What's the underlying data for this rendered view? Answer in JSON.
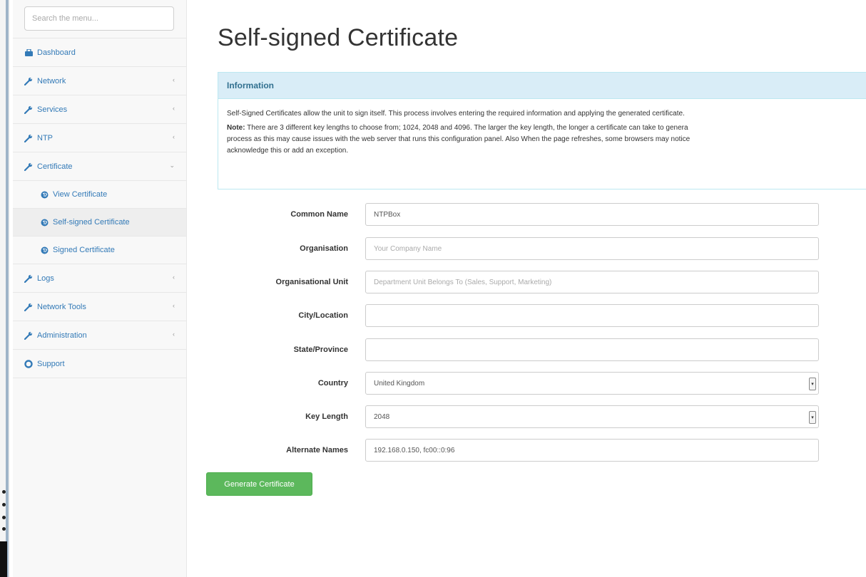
{
  "search": {
    "placeholder": "Search the menu..."
  },
  "sidebar": {
    "items": [
      {
        "label": "Dashboard",
        "icon": "dashboard-icon"
      },
      {
        "label": "Network",
        "icon": "wrench-icon",
        "has_children": true
      },
      {
        "label": "Services",
        "icon": "wrench-icon",
        "has_children": true
      },
      {
        "label": "NTP",
        "icon": "wrench-icon",
        "has_children": true
      },
      {
        "label": "Certificate",
        "icon": "wrench-icon",
        "expanded": true,
        "children": [
          {
            "label": "View Certificate",
            "icon": "certificate-icon"
          },
          {
            "label": "Self-signed Certificate",
            "icon": "certificate-icon",
            "active": true
          },
          {
            "label": "Signed Certificate",
            "icon": "certificate-icon"
          }
        ]
      },
      {
        "label": "Logs",
        "icon": "wrench-icon",
        "has_children": true
      },
      {
        "label": "Network Tools",
        "icon": "wrench-icon",
        "has_children": true
      },
      {
        "label": "Administration",
        "icon": "wrench-icon",
        "has_children": true
      },
      {
        "label": "Support",
        "icon": "support-icon"
      }
    ]
  },
  "page": {
    "title": "Self-signed Certificate"
  },
  "info_panel": {
    "heading": "Information",
    "line1": "Self-Signed Certificates allow the unit to sign itself. This process involves entering the required information and applying the generated certificate.",
    "note_label": "Note:",
    "note_line1": " There are 3 different key lengths to choose from; 1024, 2048 and 4096. The larger the key length, the longer a certificate can take to genera",
    "note_line2": "process as this may cause issues with the web server that runs this configuration panel. Also When the page refreshes, some browsers may notice",
    "note_line3": "acknowledge this or add an exception."
  },
  "form": {
    "common_name": {
      "label": "Common Name",
      "value": "NTPBox",
      "placeholder": ""
    },
    "organisation": {
      "label": "Organisation",
      "value": "",
      "placeholder": "Your Company Name"
    },
    "org_unit": {
      "label": "Organisational Unit",
      "value": "",
      "placeholder": "Department Unit Belongs To (Sales, Support, Marketing)"
    },
    "city": {
      "label": "City/Location",
      "value": "",
      "placeholder": ""
    },
    "state": {
      "label": "State/Province",
      "value": "",
      "placeholder": ""
    },
    "country": {
      "label": "Country",
      "value": "United Kingdom"
    },
    "key_length": {
      "label": "Key Length",
      "value": "2048"
    },
    "alt_names": {
      "label": "Alternate Names",
      "value": "192.168.0.150, fc00::0:96",
      "placeholder": ""
    }
  },
  "actions": {
    "generate_label": "Generate Certificate"
  },
  "colors": {
    "accent": "#337ab7",
    "info_bg": "#d9edf7",
    "info_text": "#31708f",
    "button": "#5cb85c"
  }
}
